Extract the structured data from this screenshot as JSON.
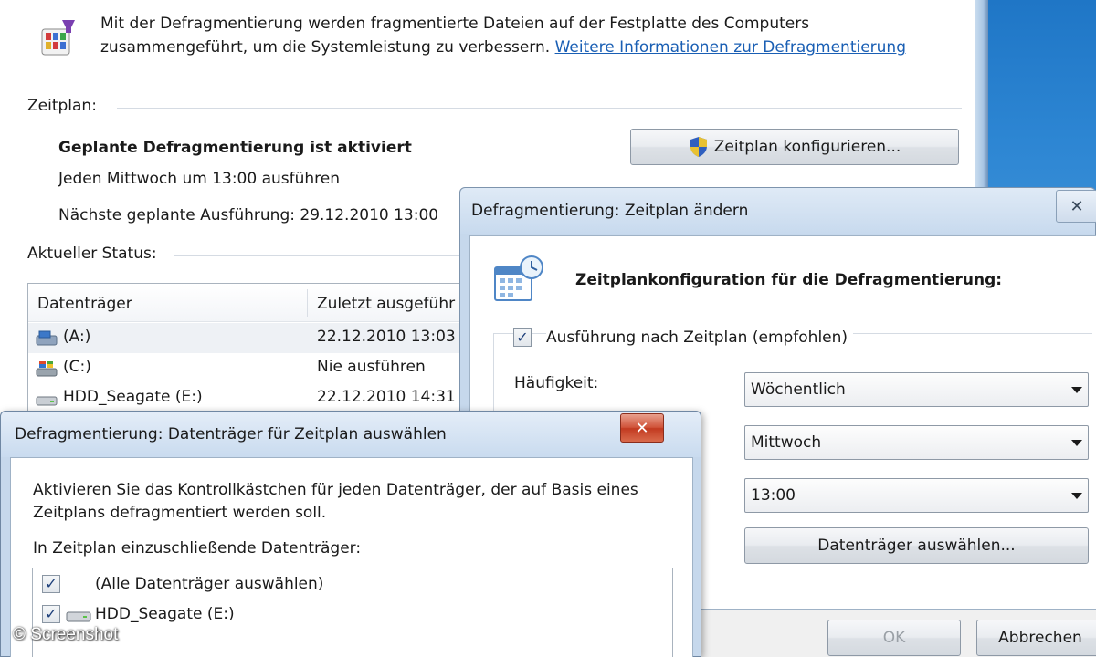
{
  "main": {
    "intro_line1": "Mit der Defragmentierung werden fragmentierte Dateien auf der Festplatte des Computers",
    "intro_line2": "zusammengeführt, um die Systemleistung zu verbessern.",
    "intro_link": "Weitere Informationen zur Defragmentierung",
    "schedule_heading": "Zeitplan:",
    "schedule_status": "Geplante Defragmentierung ist aktiviert",
    "schedule_every": "Jeden Mittwoch um 13:00 ausführen",
    "schedule_next": "Nächste geplante Ausführung: 29.12.2010 13:00",
    "configure_button": "Zeitplan konfigurieren...",
    "status_heading": "Aktueller Status:",
    "columns": [
      "Datenträger",
      "Zuletzt ausgeführ"
    ],
    "drives": [
      {
        "name": "(A:)",
        "last_run": "22.12.2010 13:03 (",
        "icon": "floppy-drive-icon"
      },
      {
        "name": "(C:)",
        "last_run": "Nie ausführen",
        "icon": "system-drive-icon"
      },
      {
        "name": "HDD_Seagate (E:)",
        "last_run": "22.12.2010 14:31 (",
        "icon": "hard-drive-icon"
      }
    ]
  },
  "schedule_dialog": {
    "title": "Defragmentierung: Zeitplan ändern",
    "close": "✕",
    "heading": "Zeitplankonfiguration für die Defragmentierung:",
    "run_on_schedule_label": "Ausführung nach Zeitplan (empfohlen)",
    "run_on_schedule_checked": true,
    "frequency_label": "Häufigkeit:",
    "frequency_value": "Wöchentlich",
    "day_value": "Mittwoch",
    "time_value": "13:00",
    "select_drives_button": "Datenträger auswählen...",
    "ok_button": "OK",
    "cancel_button": "Abbrechen"
  },
  "drives_dialog": {
    "title": "Defragmentierung: Datenträger für Zeitplan auswählen",
    "close": "✕",
    "instruction_line1": "Aktivieren Sie das Kontrollkästchen für jeden Datenträger, der auf Basis eines",
    "instruction_line2": "Zeitplans defragmentiert werden soll.",
    "list_label": "In Zeitplan einzuschließende Datenträger:",
    "items": [
      {
        "label": "(Alle Datenträger auswählen)",
        "checked": true
      },
      {
        "label": "HDD_Seagate (E:)",
        "checked": true
      }
    ]
  },
  "watermark": "© Screenshot",
  "colors": {
    "link": "#1a5fb4",
    "desktop": "#1f76c6",
    "close_red": "#c23a20"
  }
}
